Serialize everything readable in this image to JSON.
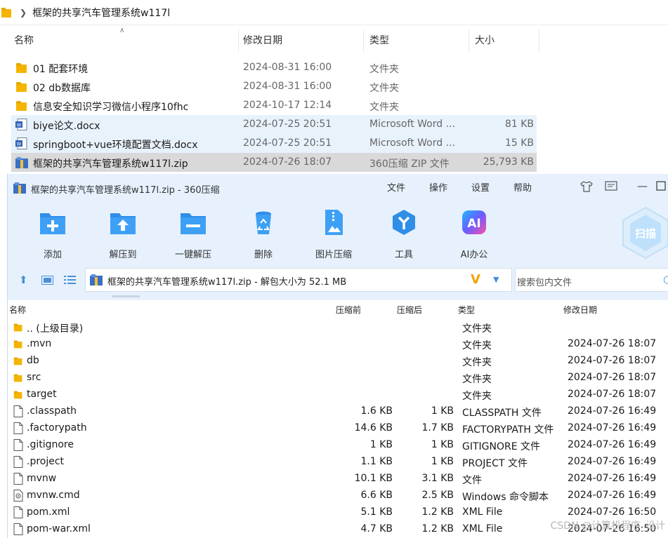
{
  "explorer": {
    "breadcrumb": "框架的共享汽车管理系统w117l",
    "columns": [
      "名称",
      "修改日期",
      "类型",
      "大小"
    ],
    "rows": [
      {
        "name": "01 配套环境",
        "date": "2024-08-31 16:00",
        "type": "文件夹",
        "size": "",
        "icon": "folder-icon"
      },
      {
        "name": "02 db数据库",
        "date": "2024-08-31 16:00",
        "type": "文件夹",
        "size": "",
        "icon": "folder-icon"
      },
      {
        "name": "信息安全知识学习微信小程序10fhc",
        "date": "2024-10-17 12:14",
        "type": "文件夹",
        "size": "",
        "icon": "folder-icon"
      },
      {
        "name": "biye论文.docx",
        "date": "2024-07-25 20:51",
        "type": "Microsoft Word ...",
        "size": "81 KB",
        "icon": "word-doc-icon"
      },
      {
        "name": "springboot+vue环境配置文档.docx",
        "date": "2024-07-25 20:51",
        "type": "Microsoft Word ...",
        "size": "15 KB",
        "icon": "word-doc-icon"
      },
      {
        "name": "框架的共享汽车管理系统w117l.zip",
        "date": "2024-07-26 18:07",
        "type": "360压缩 ZIP 文件",
        "size": "25,793 KB",
        "icon": "zip-archive-icon"
      }
    ]
  },
  "zipwin": {
    "title": "框架的共享汽车管理系统w117l.zip - 360压缩",
    "menu": [
      "文件",
      "操作",
      "设置",
      "帮助"
    ],
    "tools": [
      "添加",
      "解压到",
      "一键解压",
      "删除",
      "图片压缩",
      "工具",
      "AI办公"
    ],
    "scan_label": "扫描",
    "address": "框架的共享汽车管理系统w117l.zip - 解包大小为 52.1 MB",
    "search_placeholder": "搜索包内文件",
    "columns": [
      "名称",
      "压缩前",
      "压缩后",
      "类型",
      "修改日期"
    ],
    "rows": [
      {
        "name": ".. (上级目录)",
        "before": "",
        "after": "",
        "type": "文件夹",
        "date": "",
        "icon": "folder-icon"
      },
      {
        "name": ".mvn",
        "before": "",
        "after": "",
        "type": "文件夹",
        "date": "2024-07-26 18:07",
        "icon": "folder-icon"
      },
      {
        "name": "db",
        "before": "",
        "after": "",
        "type": "文件夹",
        "date": "2024-07-26 18:07",
        "icon": "folder-icon"
      },
      {
        "name": "src",
        "before": "",
        "after": "",
        "type": "文件夹",
        "date": "2024-07-26 18:07",
        "icon": "folder-icon"
      },
      {
        "name": "target",
        "before": "",
        "after": "",
        "type": "文件夹",
        "date": "2024-07-26 18:07",
        "icon": "folder-icon"
      },
      {
        "name": ".classpath",
        "before": "1.6 KB",
        "after": "1 KB",
        "type": "CLASSPATH 文件",
        "date": "2024-07-26 16:49",
        "icon": "file-icon"
      },
      {
        "name": ".factorypath",
        "before": "14.6 KB",
        "after": "1.7 KB",
        "type": "FACTORYPATH 文件",
        "date": "2024-07-26 16:49",
        "icon": "file-icon"
      },
      {
        "name": ".gitignore",
        "before": "1 KB",
        "after": "1 KB",
        "type": "GITIGNORE 文件",
        "date": "2024-07-26 16:49",
        "icon": "file-icon"
      },
      {
        "name": ".project",
        "before": "1.1 KB",
        "after": "1 KB",
        "type": "PROJECT 文件",
        "date": "2024-07-26 16:49",
        "icon": "file-icon"
      },
      {
        "name": "mvnw",
        "before": "10.1 KB",
        "after": "3.1 KB",
        "type": "文件",
        "date": "2024-07-26 16:49",
        "icon": "file-icon"
      },
      {
        "name": "mvnw.cmd",
        "before": "6.6 KB",
        "after": "2.5 KB",
        "type": "Windows 命令脚本",
        "date": "2024-07-26 16:49",
        "icon": "cmd-script-icon"
      },
      {
        "name": "pom.xml",
        "before": "5.1 KB",
        "after": "1.2 KB",
        "type": "XML File",
        "date": "2024-07-26 16:50",
        "icon": "file-icon"
      },
      {
        "name": "pom-war.xml",
        "before": "4.7 KB",
        "after": "1.2 KB",
        "type": "XML File",
        "date": "2024-07-26 16:50",
        "icon": "file-icon"
      }
    ]
  },
  "watermark": "CSDN @计算机程序_设计"
}
